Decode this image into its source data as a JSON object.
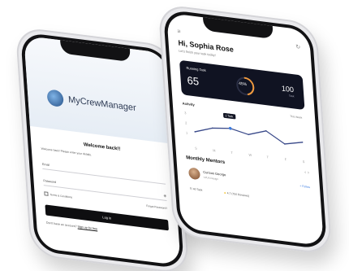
{
  "login_screen": {
    "brand": "MyCrewManager",
    "welcome": "Welcome back!!",
    "subtitle": "Welcome back! Please enter your details.",
    "email_label": "Email",
    "password_label": "Password",
    "terms": "Terms & Conditions",
    "forgot": "Forgot Password?",
    "login_button": "Log in",
    "no_account": "Don't have an account?",
    "signup": "Sign up for free"
  },
  "dashboard_screen": {
    "greeting": "Hi, Sophia Rose",
    "subtitle": "Let's finish your task today!",
    "running_task": {
      "label": "Running Task",
      "count": "65",
      "progress_label": "45%",
      "progress": 0.45,
      "total": "100",
      "total_label": "Task"
    },
    "activity": {
      "label": "Activity",
      "filter": "This Week",
      "tooltip": "2 Task",
      "days": [
        "S",
        "M",
        "T",
        "W",
        "T",
        "F",
        "S"
      ],
      "y_ticks": [
        "3",
        "2",
        "1"
      ],
      "values": [
        1.2,
        1.8,
        2.0,
        1.6,
        2.2,
        1.1,
        1.5
      ]
    },
    "monthly_mentors": "Monthly Mentors",
    "mentor": {
      "name": "Curious George",
      "role": "UI/UX Design",
      "follow": "+ Follow",
      "tasks": "40 Task",
      "rating": "4.7 (750 Reviews)"
    }
  },
  "colors": {
    "dark": "#101322",
    "accent": "#3a7be0",
    "ring": "#f09a3e"
  }
}
